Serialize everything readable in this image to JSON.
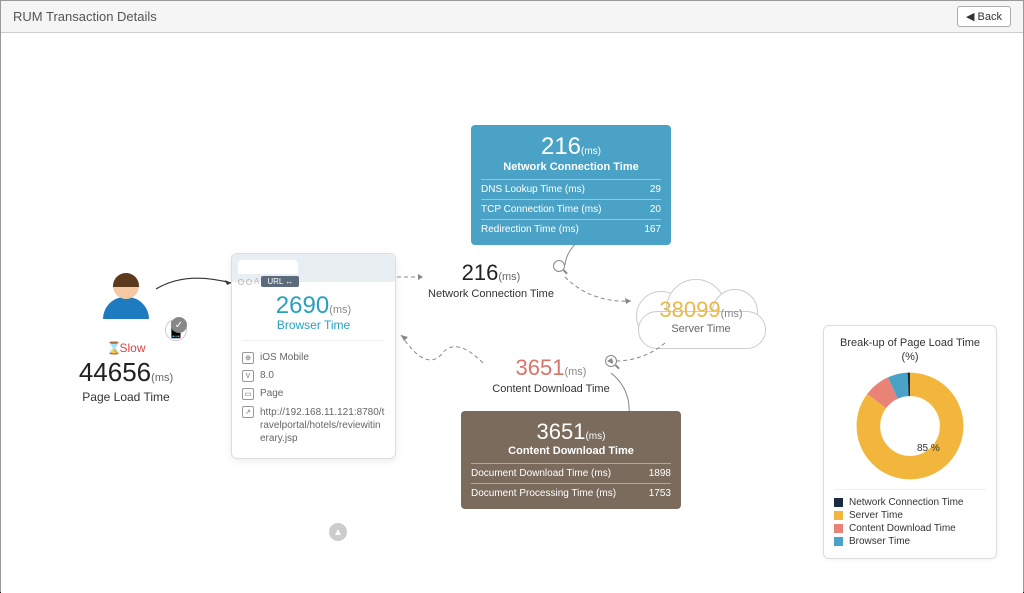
{
  "header": {
    "title": "RUM Transaction Details",
    "back_label": "Back"
  },
  "user": {
    "status_label": "Slow",
    "page_load_value": "44656",
    "unit": "(ms)",
    "caption": "Page Load Time"
  },
  "browser": {
    "time_value": "2690",
    "unit": "(ms)",
    "caption": "Browser Time",
    "url_pill": "URL",
    "meta": {
      "device": "iOS Mobile",
      "version": "8.0",
      "type": "Page",
      "url": "http://192.168.11.121:8780/travelportal/hotels/reviewitinerary.jsp"
    }
  },
  "network_inline": {
    "value": "216",
    "unit": "(ms)",
    "caption": "Network Connection Time"
  },
  "network_card": {
    "value": "216",
    "unit": "(ms)",
    "caption": "Network Connection Time",
    "rows": [
      {
        "label": "DNS Lookup Time (ms)",
        "value": "29"
      },
      {
        "label": "TCP Connection Time (ms)",
        "value": "20"
      },
      {
        "label": "Redirection Time (ms)",
        "value": "167"
      }
    ]
  },
  "server": {
    "value": "38099",
    "unit": "(ms)",
    "caption": "Server Time"
  },
  "content_inline": {
    "value": "3651",
    "unit": "(ms)",
    "caption": "Content Download Time"
  },
  "content_card": {
    "value": "3651",
    "unit": "(ms)",
    "caption": "Content Download Time",
    "rows": [
      {
        "label": "Document Download Time (ms)",
        "value": "1898"
      },
      {
        "label": "Document Processing Time (ms)",
        "value": "1753"
      }
    ]
  },
  "donut": {
    "title": "Break-up of Page Load Time (%)",
    "center_label": "85 %",
    "legend": [
      {
        "label": "Network Connection Time",
        "color": "#1b2b44"
      },
      {
        "label": "Server Time",
        "color": "#f2b63d"
      },
      {
        "label": "Content Download Time",
        "color": "#e98277"
      },
      {
        "label": "Browser Time",
        "color": "#4aa3c7"
      }
    ]
  },
  "chart_data": {
    "type": "pie",
    "title": "Break-up of Page Load Time (%)",
    "series": [
      {
        "name": "Network Connection Time",
        "value": 0.5,
        "color": "#1b2b44"
      },
      {
        "name": "Server Time",
        "value": 85,
        "color": "#f2b63d"
      },
      {
        "name": "Content Download Time",
        "value": 8,
        "color": "#e98277"
      },
      {
        "name": "Browser Time",
        "value": 6,
        "color": "#4aa3c7"
      }
    ]
  }
}
